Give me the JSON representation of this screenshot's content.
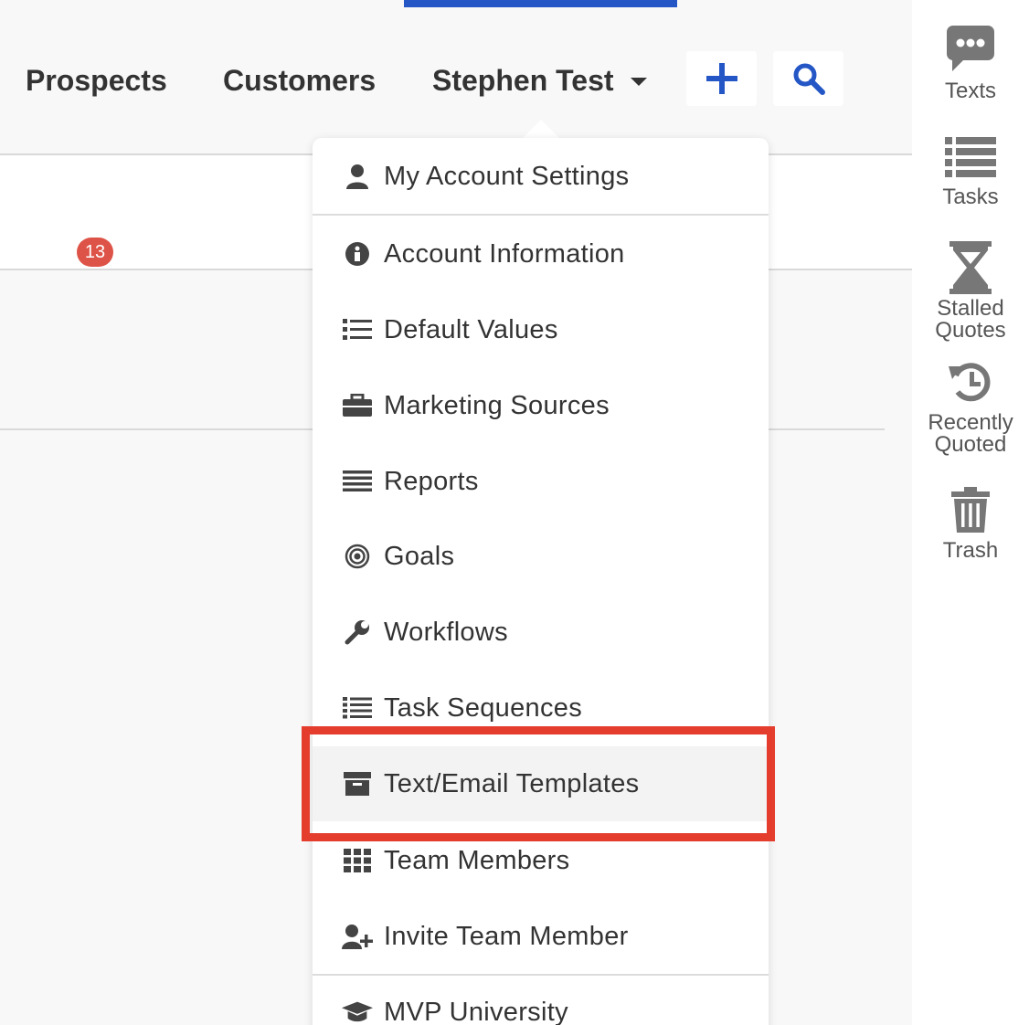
{
  "topnav": {
    "prospects_label": "Prospects",
    "customers_label": "Customers",
    "user_label": "Stephen Test",
    "add_icon": "plus-icon",
    "search_icon": "search-icon",
    "accent_color": "#2457c5"
  },
  "dropdown": {
    "items": [
      {
        "label": "My Account Settings",
        "icon": "user-icon"
      },
      {
        "label": "Account Information",
        "icon": "info-circle-icon"
      },
      {
        "label": "Default Values",
        "icon": "list-icon"
      },
      {
        "label": "Marketing Sources",
        "icon": "briefcase-icon"
      },
      {
        "label": "Reports",
        "icon": "bars-icon"
      },
      {
        "label": "Goals",
        "icon": "bullseye-icon"
      },
      {
        "label": "Workflows",
        "icon": "wrench-icon"
      },
      {
        "label": "Task Sequences",
        "icon": "list-icon"
      },
      {
        "label": "Text/Email Templates",
        "icon": "archive-icon"
      },
      {
        "label": "Team Members",
        "icon": "grid-icon"
      },
      {
        "label": "Invite Team Member",
        "icon": "user-plus-icon"
      },
      {
        "label": "MVP University",
        "icon": "graduation-cap-icon"
      }
    ],
    "highlighted_item": "Text/Email Templates",
    "highlight_color": "#e43d2e"
  },
  "rightbar": {
    "texts_label": "Texts",
    "tasks_label": "Tasks",
    "stalled_label_line1": "Stalled",
    "stalled_label_line2": "Quotes",
    "stalled_badge": "13",
    "recent_label_line1": "Recently",
    "recent_label_line2": "Quoted",
    "trash_label": "Trash"
  }
}
